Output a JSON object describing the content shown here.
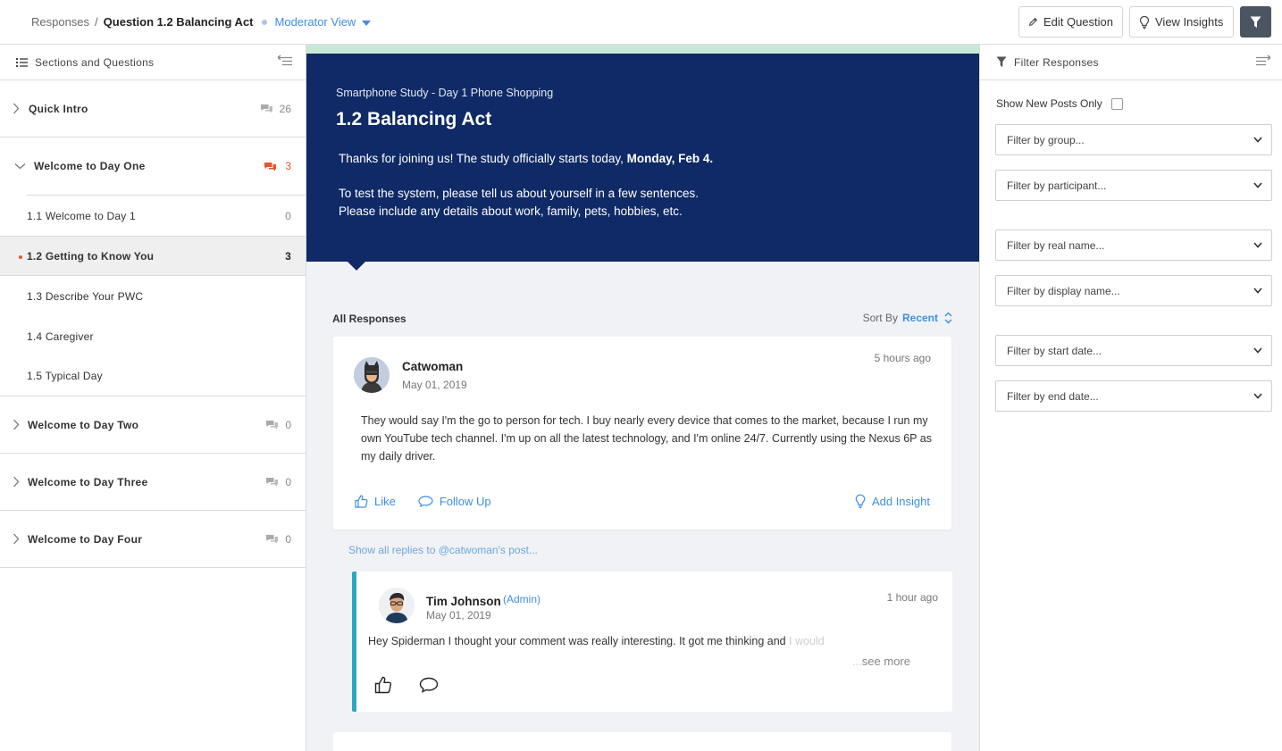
{
  "breadcrumb": {
    "root": "Responses",
    "separator": "/",
    "current": "Question 1.2 Balancing Act",
    "view": "Moderator View"
  },
  "toolbar": {
    "edit_label": "Edit Question",
    "insights_label": "View Insights"
  },
  "sidebar": {
    "title": "Sections and Questions",
    "sections": [
      {
        "label": "Quick Intro",
        "count": "26"
      },
      {
        "label": "Welcome to Day One",
        "count": "3"
      },
      {
        "label": "Welcome to Day Two",
        "count": "0"
      },
      {
        "label": "Welcome to Day Three",
        "count": "0"
      },
      {
        "label": "Welcome to Day Four",
        "count": "0"
      }
    ],
    "questions": [
      {
        "label": "1.1 Welcome to Day 1",
        "count": "0"
      },
      {
        "label": "1.2 Getting to Know You",
        "count": "3"
      },
      {
        "label": "1.3 Describe Your PWC",
        "count": ""
      },
      {
        "label": "1.4 Caregiver",
        "count": ""
      },
      {
        "label": "1.5 Typical Day",
        "count": ""
      }
    ]
  },
  "question": {
    "study": "Smartphone Study - Day 1 Phone Shopping",
    "title": "1.2 Balancing Act",
    "intro_prefix": "Thanks for joining us! The study officially starts today, ",
    "intro_date": "Monday, Feb 4.",
    "line1": "To test the system, please tell us about yourself in a few sentences.",
    "line2": "Please include any details about work, family, pets, hobbies, etc."
  },
  "responses": {
    "heading": "All Responses",
    "sort_label": "Sort By",
    "sort_value": "Recent",
    "post": {
      "user": "Catwoman",
      "date": "May 01, 2019",
      "ago": "5 hours ago",
      "body": "They would say I'm the go to person for tech. I buy nearly every device that comes to the market, because I run my own YouTube tech channel.  I'm up on all the latest technology, and I'm online 24/7. Currently using the Nexus 6P as my daily driver.",
      "like": "Like",
      "follow": "Follow Up",
      "insight": "Add Insight"
    },
    "show_replies": "Show all replies to @catwoman's post...",
    "reply": {
      "user": "Tim Johnson",
      "role": "(Admin)",
      "date": "May 01, 2019",
      "ago": "1 hour ago",
      "body": "Hey Spiderman I thought your comment was really interesting. It got me thinking and ",
      "body_faded": "I would",
      "ellipsis": "...",
      "see_more": "see more"
    }
  },
  "filters": {
    "title": "Filter Responses",
    "new_posts": "Show New Posts Only",
    "selects": [
      "Filter by group...",
      "Filter by participant...",
      "Filter by real name...",
      "Filter by display name...",
      "Filter by start date...",
      "Filter by end date..."
    ]
  },
  "colors": {
    "accent": "#3f8fe0",
    "hero": "#0f2a66",
    "alert": "#e2572c",
    "reply_border": "#2ba9c4"
  }
}
